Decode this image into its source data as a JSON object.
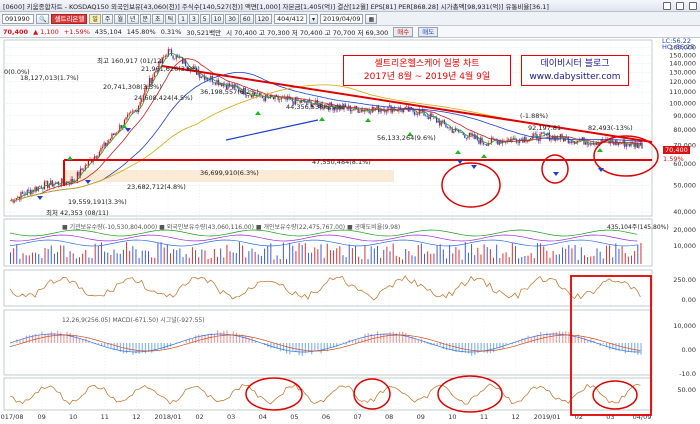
{
  "titlebar": {
    "text": "[0600] 키움종합차트 - KOSDAQ150 외국인보유[43,060(천)] 주식수[140,527(천)] 액면[1,000] 자본금[1,405(억)] 결산[12월] EPS[81] PER[868.28] 시가총액[98,931(억)] 유통비율[36.1]"
  },
  "toolbar": {
    "code": "091990",
    "name": "셀트리온헬",
    "period_buttons": [
      "일",
      "주",
      "월",
      "년",
      "분",
      "초",
      "틱"
    ],
    "active_period": "일",
    "intervals": [
      "1",
      "3",
      "5",
      "10",
      "30",
      "60",
      "120"
    ],
    "count": "404/412",
    "date": "2019/04/09"
  },
  "pricebar": {
    "last": "70,400",
    "change": "▲ 1,100",
    "pct": "+1.59%",
    "volume": "435,104",
    "turnover": "145.80%",
    "ratio": "0.31%",
    "amount": "30,521백만",
    "info": "시 70,400 고 70,300 저 70,400 고 70,700 저 69,300",
    "btn_buy": "매수",
    "btn_sell": "매도"
  },
  "annotation": {
    "line1": "셀트리온헬스케어 일봉 차트",
    "line2": "2017년 8월 ~ 2019년 4월 9일",
    "blog1": "데이비시터 블로그",
    "blog2": "www.dabysitter.com"
  },
  "labels": {
    "zero": "0(0.0%)",
    "peak": "최고 160,917 (01/12)",
    "v1": "18,127,013(1.7%)",
    "v2": "21,961,626(3.6%)",
    "v3": "20,741,308(3.3%)",
    "v4": "24,608,424(4.5%)",
    "v5": "36,198,557(6.2%)",
    "v6": "44,356,538(5.9%)",
    "v7": "56,133,264(9.6%)",
    "v8": "47,550,484(8.1%)",
    "v9": "36,699,910(6.3%)",
    "v10": "23,682,712(4.8%)",
    "v11": "19,559,191(3.3%)",
    "low": "최저 42,353 (08/11)",
    "pct1": "(-1.88%)",
    "pct2": "82,493(-13%)",
    "pct3": "92,197.81",
    "lc": "LC:56.22",
    "hc": "HC:-56.25",
    "volume_legend": "■ 기관보유수량(-10,530,804,000) ■ 외국인보유수량(43,060,116,00) ■ 개인보유수량(22,475,767,00) ■ 공매도비율(9.98)",
    "vol_value": "435,104주(145.80%)",
    "macd_legend": "12,26,9(256.05) MACD(-671.50) 시그널(-927.55)",
    "last_price_tag": "70,400",
    "last_pct_tag": "1.59%"
  },
  "axes": {
    "price_ticks": [
      "160,000",
      "150,000",
      "140,000",
      "130,000",
      "120,000",
      "110,000",
      "100,000",
      "90,000",
      "80,000",
      "70,000",
      "60,000",
      "50,000",
      "40,000"
    ],
    "vol_ticks": [
      "20,000",
      "10,000"
    ],
    "osc_ticks": [
      "250.00",
      "0.00"
    ],
    "macd_ticks": [
      "10,000",
      "0.00",
      "-10.0"
    ],
    "stoch_ticks": [
      "50.00"
    ],
    "x_ticks": [
      "2017/08",
      "09",
      "10",
      "11",
      "12",
      "2018/01",
      "02",
      "03",
      "04",
      "05",
      "06",
      "07",
      "08",
      "09",
      "10",
      "11",
      "12",
      "2019/01",
      "02",
      "03",
      "04/09"
    ]
  },
  "colors": {
    "up": "#d11111",
    "down": "#1d3fd6",
    "trend": "#e00000",
    "annotation_text": "#e00000",
    "annotation_blog": "#1a1a8a",
    "band": "#fbe8d0",
    "ma5": "#1f9b1f",
    "ma20": "#c82020",
    "ma60": "#1a3fd0",
    "ma120": "#d6a800"
  },
  "chart_data": {
    "type": "line",
    "title": "셀트리온헬스케어 일봉 차트",
    "subtitle": "2017년 8월 ~ 2019년 4월 9일",
    "x": [
      "2017/08",
      "2017/09",
      "2017/10",
      "2017/11",
      "2017/12",
      "2018/01",
      "2018/02",
      "2018/03",
      "2018/04",
      "2018/05",
      "2018/06",
      "2018/07",
      "2018/08",
      "2018/09",
      "2018/10",
      "2018/11",
      "2018/12",
      "2019/01",
      "2019/02",
      "2019/03",
      "2019/04"
    ],
    "series": [
      {
        "name": "close",
        "values": [
          44000,
          50000,
          52000,
          70000,
          95000,
          155000,
          128000,
          115000,
          105000,
          102000,
          98000,
          95000,
          96000,
          93000,
          80000,
          72000,
          74000,
          76000,
          73000,
          72000,
          70400
        ]
      }
    ],
    "ylim": [
      40000,
      165000
    ],
    "price_scale": "log",
    "peak": {
      "date": "01/12",
      "price": 160917
    },
    "low": {
      "date": "08/11",
      "price": 42353
    },
    "last": 70400
  }
}
